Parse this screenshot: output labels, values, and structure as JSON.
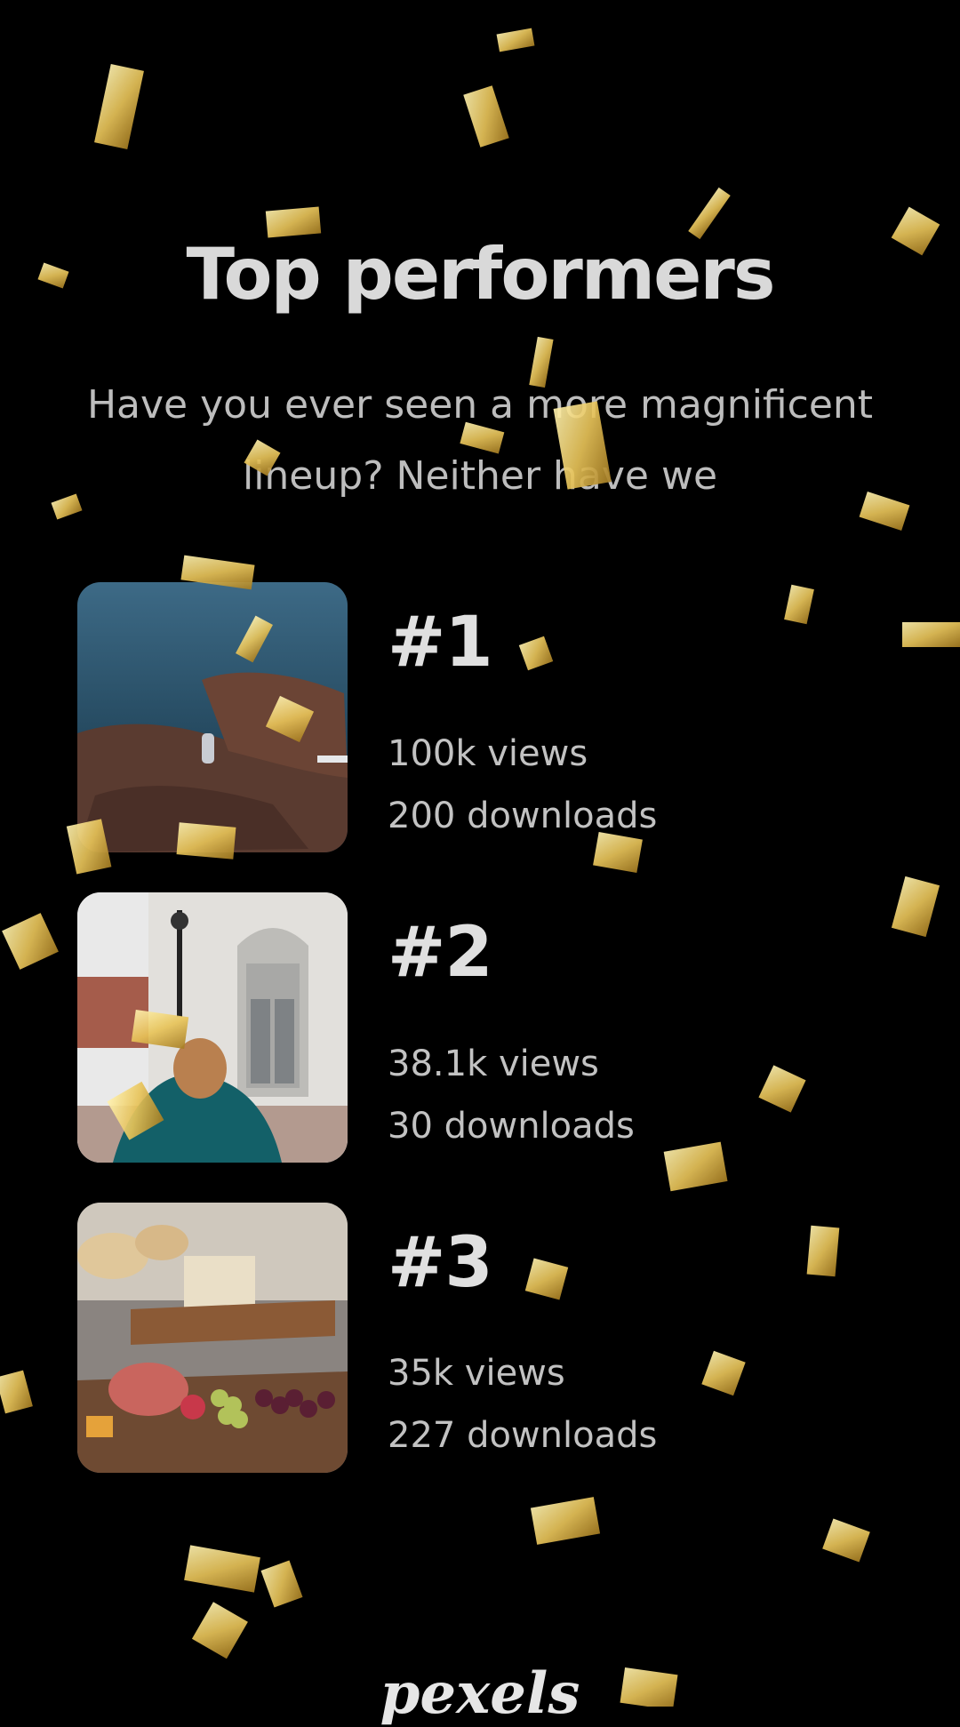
{
  "page": {
    "title": "Top performers",
    "subtitle_line1": "Have you ever seen a more magnificent",
    "subtitle_line2": "lineup? Neither have we"
  },
  "performers": [
    {
      "rank": "#1",
      "views": "100k views",
      "downloads": "200 downloads",
      "image": "hands-ring-photo"
    },
    {
      "rank": "#2",
      "views": "38.1k views",
      "downloads": "30 downloads",
      "image": "city-hall-photo"
    },
    {
      "rank": "#3",
      "views": "35k views",
      "downloads": "227 downloads",
      "image": "food-platter-photo"
    }
  ],
  "brand": {
    "logo_text": "pexels"
  },
  "colors": {
    "background": "#000000",
    "confetti": "#e8c45a",
    "text": "#d9d9d9"
  }
}
